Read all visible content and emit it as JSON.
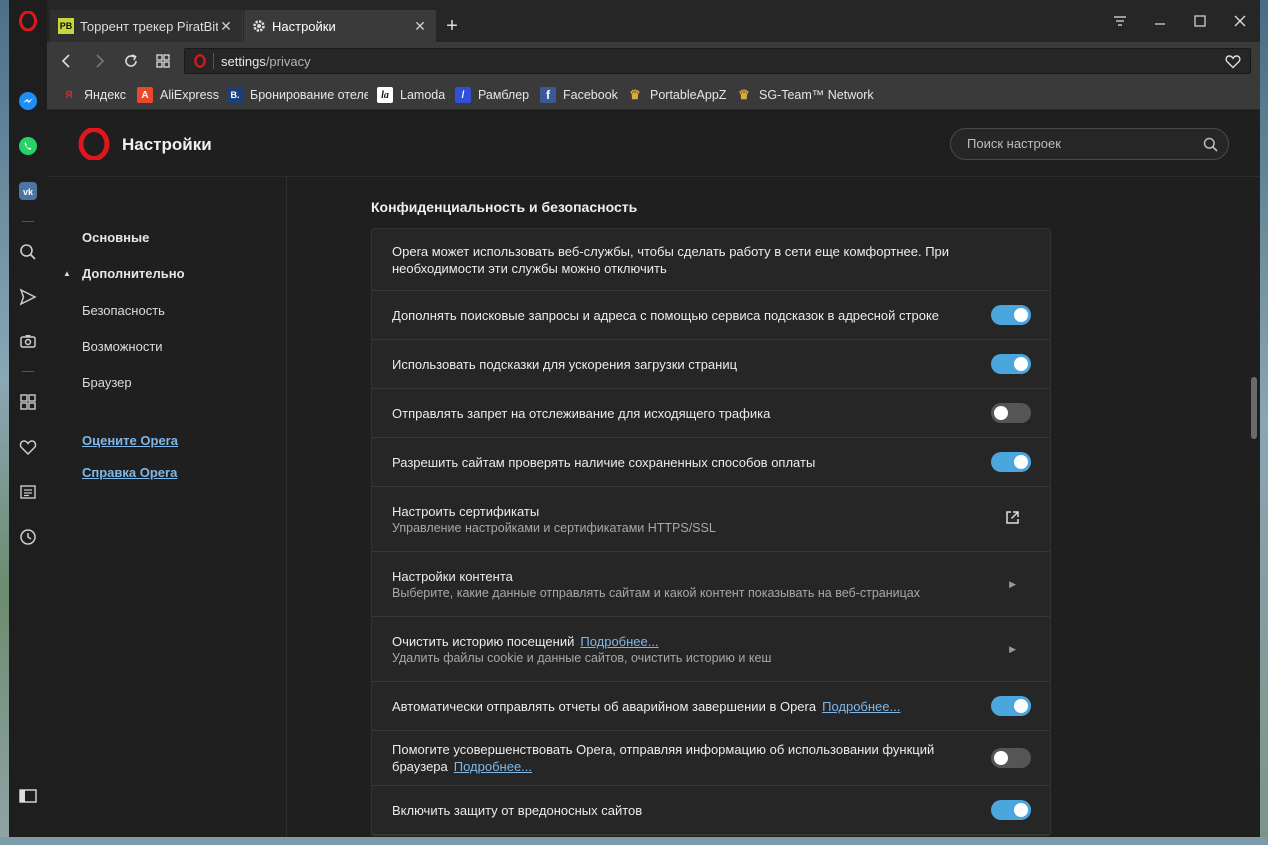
{
  "tabs": [
    {
      "title": "Торрент трекер PiratBit Pi",
      "favicon": "PB",
      "active": false
    },
    {
      "title": "Настройки",
      "favicon": "gear",
      "active": true
    }
  ],
  "address": {
    "host": "settings",
    "path": "/privacy"
  },
  "bookmarks": [
    {
      "label": "Яндекс",
      "icon": "Я",
      "color": "#d42b2b"
    },
    {
      "label": "AliExpress",
      "icon": "A",
      "color": "#e8492b"
    },
    {
      "label": "Бронирование отеле",
      "icon": "B.",
      "color": "#1a3f7a"
    },
    {
      "label": "Lamoda",
      "icon": "la",
      "color": "#111111"
    },
    {
      "label": "Рамблер",
      "icon": "/",
      "color": "#3150d8"
    },
    {
      "label": "Facebook",
      "icon": "f",
      "color": "#3b5998"
    },
    {
      "label": "PortableAppZ",
      "icon": "♛",
      "color": "#c9a133"
    },
    {
      "label": "SG-Team™ Network",
      "icon": "♛",
      "color": "#c9a133"
    }
  ],
  "header": {
    "title": "Настройки",
    "search_placeholder": "Поиск настроек"
  },
  "nav": {
    "basic": "Основные",
    "advanced": "Дополнительно",
    "security": "Безопасность",
    "features": "Возможности",
    "browser": "Браузер",
    "rate": "Оцените Opera",
    "help": "Справка Opera"
  },
  "section": {
    "title": "Конфиденциальность и безопасность",
    "intro": "Opera может использовать веб-службы, чтобы сделать работу в сети еще комфортнее. При необходимости эти службы можно отключить",
    "more_label": "Подробнее...",
    "rows": [
      {
        "label": "Дополнять поисковые запросы и адреса с помощью сервиса подсказок в адресной строке",
        "on": true
      },
      {
        "label": "Использовать подсказки для ускорения загрузки страниц",
        "on": true
      },
      {
        "label": "Отправлять запрет на отслеживание для исходящего трафика",
        "on": false
      },
      {
        "label": "Разрешить сайтам проверять наличие сохраненных способов оплаты",
        "on": true
      }
    ],
    "certificates": {
      "title": "Настроить сертификаты",
      "sub": "Управление настройками и сертификатами HTTPS/SSL"
    },
    "content_settings": {
      "title": "Настройки контента",
      "sub": "Выберите, какие данные отправлять сайтам и какой контент показывать на веб-страницах"
    },
    "clear_history": {
      "title": "Очистить историю посещений",
      "sub": "Удалить файлы cookie и данные сайтов, очистить историю и кеш"
    },
    "crash_reports": {
      "label": "Автоматически отправлять отчеты об аварийном завершении в Opera",
      "on": true
    },
    "improve": {
      "label_1": "Помогите усовершенствовать Opera, отправляя информацию об использовании функций",
      "label_2": "браузера",
      "on": false
    },
    "malware": {
      "label": "Включить защиту от вредоносных сайтов",
      "on": true
    }
  }
}
